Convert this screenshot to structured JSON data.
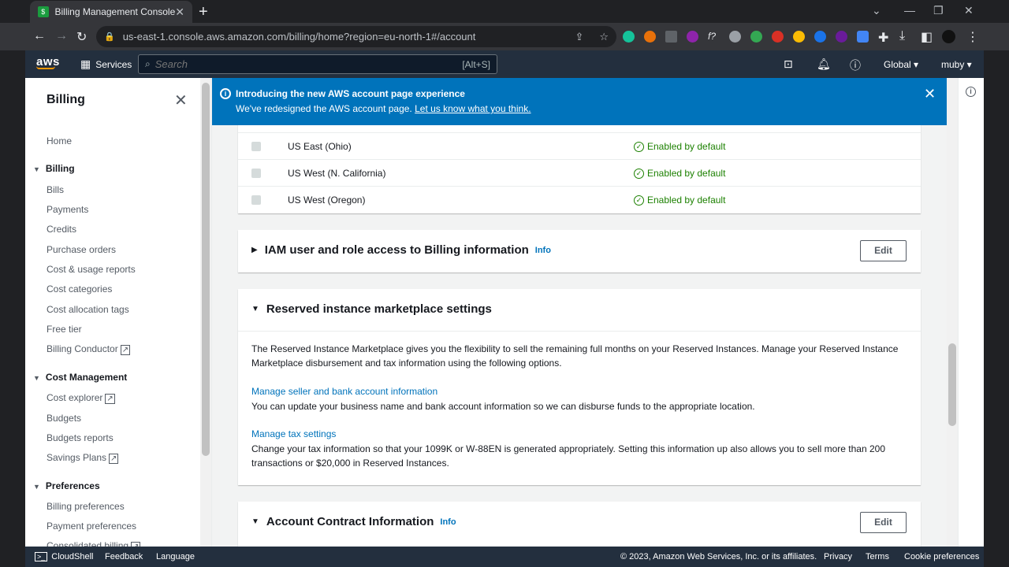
{
  "browser": {
    "tab_title": "Billing Management Console",
    "url": "us-east-1.console.aws.amazon.com/billing/home?region=eu-north-1#/account"
  },
  "aws_nav": {
    "logo": "aws",
    "services_label": "Services",
    "search_placeholder": "Search",
    "search_shortcut": "[Alt+S]",
    "region_label": "Global",
    "user_label": "muby"
  },
  "sidebar": {
    "title": "Billing",
    "home": "Home",
    "sections": [
      {
        "title": "Billing",
        "items": [
          "Bills",
          "Payments",
          "Credits",
          "Purchase orders",
          "Cost & usage reports",
          "Cost categories",
          "Cost allocation tags",
          "Free tier",
          "Billing Conductor"
        ]
      },
      {
        "title": "Cost Management",
        "items": [
          "Cost explorer",
          "Budgets",
          "Budgets reports",
          "Savings Plans"
        ]
      },
      {
        "title": "Preferences",
        "items": [
          "Billing preferences",
          "Payment preferences",
          "Consolidated billing"
        ]
      }
    ]
  },
  "flash": {
    "heading": "Introducing the new AWS account page experience",
    "body": "We've redesigned the AWS account page.",
    "link": "Let us know what you think."
  },
  "regions": [
    {
      "name": "US East (Ohio)",
      "status": "Enabled by default"
    },
    {
      "name": "US West (N. California)",
      "status": "Enabled by default"
    },
    {
      "name": "US West (Oregon)",
      "status": "Enabled by default"
    }
  ],
  "iam_section": {
    "title": "IAM user and role access to Billing information",
    "info": "Info",
    "edit": "Edit"
  },
  "ri_section": {
    "title": "Reserved instance marketplace settings",
    "intro": "The Reserved Instance Marketplace gives you the flexibility to sell the remaining full months on your Reserved Instances. Manage your Reserved Instance Marketplace disbursement and tax information using the following options.",
    "link1": "Manage seller and bank account information",
    "desc1": "You can update your business name and bank account information so we can disburse funds to the appropriate location.",
    "link2": "Manage tax settings",
    "desc2": "Change your tax information so that your 1099K or W-88EN is generated appropriately. Setting this information up also allows you to sell more than 200 transactions or $20,000 in Reserved Instances."
  },
  "contract_section": {
    "title": "Account Contract Information",
    "info": "Info",
    "edit": "Edit"
  },
  "footer": {
    "cloudshell": "CloudShell",
    "feedback": "Feedback",
    "language": "Language",
    "copyright": "© 2023, Amazon Web Services, Inc. or its affiliates.",
    "privacy": "Privacy",
    "terms": "Terms",
    "cookies": "Cookie preferences"
  }
}
